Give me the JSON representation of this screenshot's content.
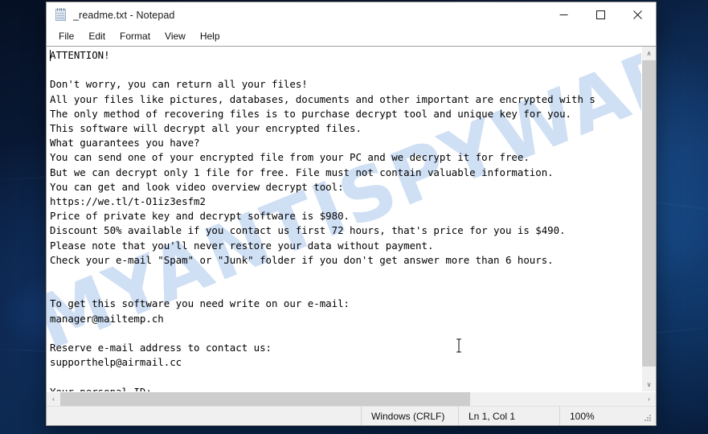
{
  "window": {
    "title": "_readme.txt - Notepad",
    "icon": "notepad-document-icon",
    "minimize_label": "Minimize",
    "maximize_label": "Maximize",
    "close_label": "Close"
  },
  "menu": {
    "items": [
      {
        "label": "File"
      },
      {
        "label": "Edit"
      },
      {
        "label": "Format"
      },
      {
        "label": "View"
      },
      {
        "label": "Help"
      }
    ]
  },
  "document": {
    "content": "ATTENTION!\n\nDon't worry, you can return all your files!\nAll your files like pictures, databases, documents and other important are encrypted with s\nThe only method of recovering files is to purchase decrypt tool and unique key for you.\nThis software will decrypt all your encrypted files.\nWhat guarantees you have?\nYou can send one of your encrypted file from your PC and we decrypt it for free.\nBut we can decrypt only 1 file for free. File must not contain valuable information.\nYou can get and look video overview decrypt tool:\nhttps://we.tl/t-O1iz3esfm2\nPrice of private key and decrypt software is $980.\nDiscount 50% available if you contact us first 72 hours, that's price for you is $490.\nPlease note that you'll never restore your data without payment.\nCheck your e-mail \"Spam\" or \"Junk\" folder if you don't get answer more than 6 hours.\n\n\nTo get this software you need write on our e-mail:\nmanager@mailtemp.ch\n\nReserve e-mail address to contact us:\nsupporthelp@airmail.cc\n\nYour personal ID:"
  },
  "watermark": {
    "text": "MYANTISPYWARE.COM"
  },
  "scrollbars": {
    "up_arrow": "∧",
    "down_arrow": "∨",
    "left_arrow": "‹",
    "right_arrow": "›"
  },
  "statusbar": {
    "line_ending": "Windows (CRLF)",
    "cursor_position": "Ln 1, Col 1",
    "zoom": "100%"
  },
  "colors": {
    "window_bg": "#ffffff",
    "chrome_bg": "#f0f0f0",
    "scroll_thumb": "#cdcdcd",
    "text": "#000000",
    "watermark": "#6096db",
    "close_hover": "#e81123",
    "desktop": "#0d2a54"
  }
}
